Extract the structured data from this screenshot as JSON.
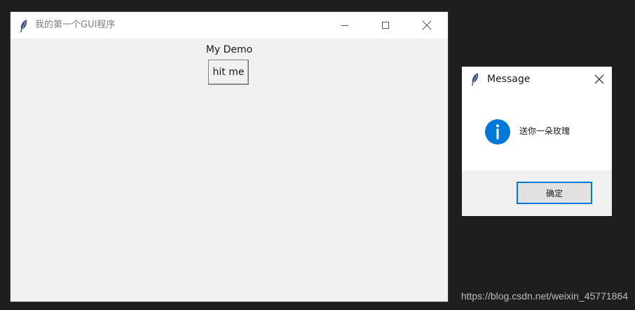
{
  "main_window": {
    "title": "我的第一个GUI程序",
    "label": "My Demo",
    "button_label": "hit me"
  },
  "message_box": {
    "title": "Message",
    "text": "送你一朵玫瑰",
    "ok_label": "确定",
    "icon": "info-icon",
    "accent": "#0078d7"
  },
  "watermark": "https://blog.csdn.net/weixin_45771864"
}
